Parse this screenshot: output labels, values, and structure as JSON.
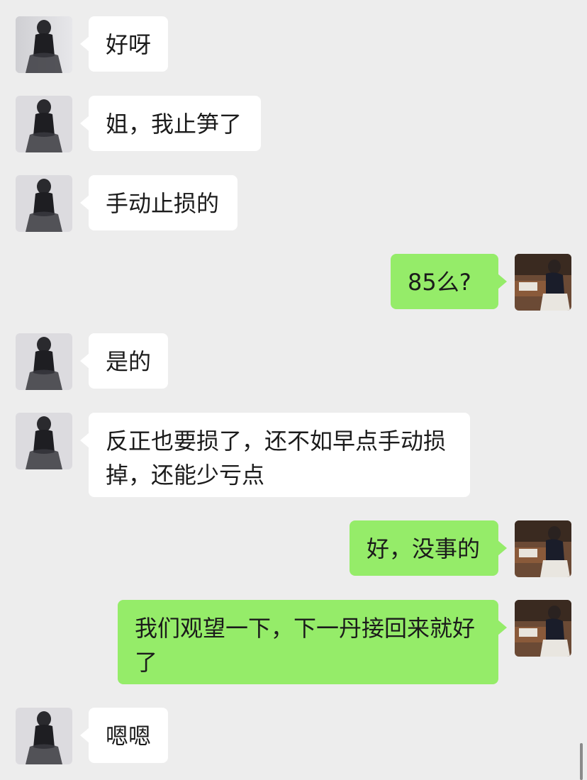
{
  "messages": [
    {
      "side": "left",
      "text": "好呀"
    },
    {
      "side": "left",
      "text": "姐，我止笋了"
    },
    {
      "side": "left",
      "text": "手动止损的"
    },
    {
      "side": "right",
      "text": "85么?"
    },
    {
      "side": "left",
      "text": "是的"
    },
    {
      "side": "left",
      "text": "反正也要损了，还不如早点手动损掉，还能少亏点"
    },
    {
      "side": "right",
      "text": "好，没事的"
    },
    {
      "side": "right",
      "text": "我们观望一下，下一丹接回来就好了"
    },
    {
      "side": "left",
      "text": "嗯嗯"
    }
  ],
  "avatars": {
    "contact": "contact-avatar-woman-black-dress",
    "self": "self-avatar-woman-reading-desk"
  },
  "colors": {
    "background": "#ededed",
    "incoming_bubble": "#ffffff",
    "outgoing_bubble": "#95ec69",
    "text": "#1b1b1b"
  }
}
